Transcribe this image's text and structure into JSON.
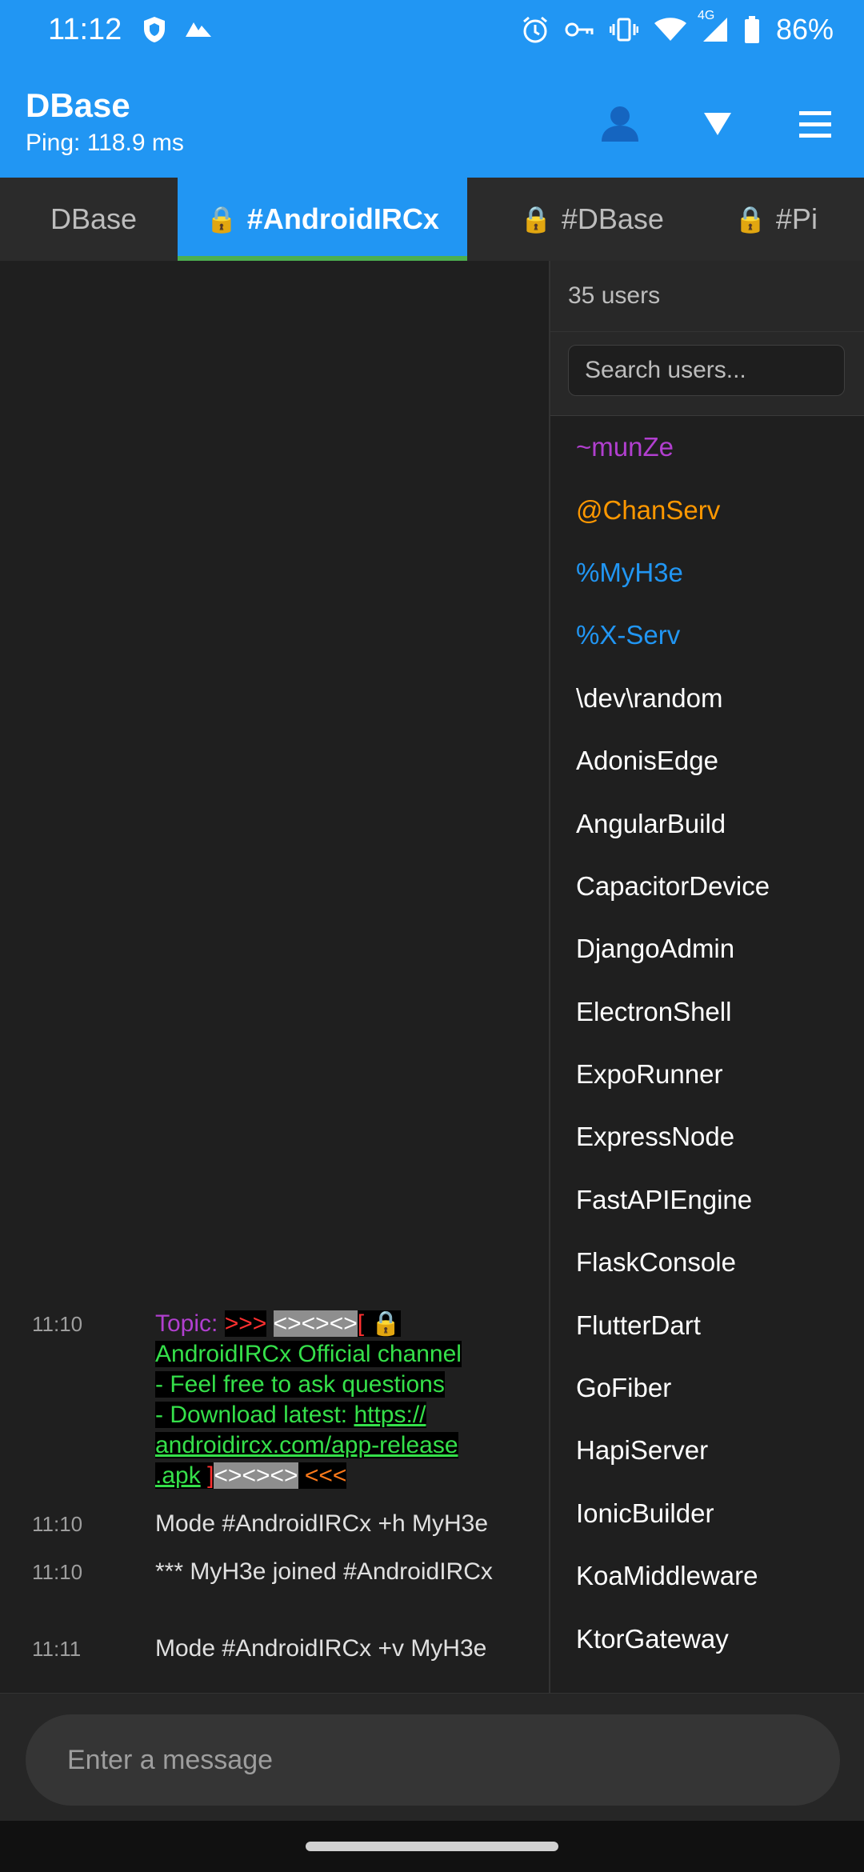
{
  "status_bar": {
    "time": "11:12",
    "battery_percent": "86%",
    "network_label": "4G",
    "icons": [
      "shield-icon",
      "drive-icon",
      "alarm-icon",
      "vpn-key-icon",
      "vibrate-icon",
      "wifi-icon",
      "signal-icon",
      "battery-icon"
    ]
  },
  "app_bar": {
    "title": "DBase",
    "subtitle": "Ping: 118.9 ms",
    "actions": [
      "users-icon",
      "dropdown-icon",
      "menu-icon"
    ],
    "accent": "#2196f3"
  },
  "tabs": [
    {
      "label": "DBase",
      "locked": false,
      "active": false
    },
    {
      "label": "#AndroidIRCx",
      "locked": true,
      "active": true
    },
    {
      "label": "#DBase",
      "locked": true,
      "active": false
    },
    {
      "label": "#Pi",
      "locked": true,
      "active": false
    }
  ],
  "messages": {
    "topic": {
      "time": "11:10",
      "label": "Topic:",
      "left_arrows": ">>>",
      "deco": "<><><>",
      "open_bracket": "[",
      "channel_line": "AndroidIRCx Official channel",
      "ask_line": "- Feel free to ask questions",
      "download_prefix": "- Download latest: ",
      "link": "https://androidircx.com/app-release.apk",
      "link_1": "https://",
      "link_2": "androidircx.com/app-release",
      "link_3": ".apk",
      "close_bracket": "]",
      "deco2": "<><><>",
      "right_arrows": "<<<"
    },
    "mode1": {
      "time": "11:10",
      "text": "Mode #AndroidIRCx +h MyH3e"
    },
    "join": {
      "time": "11:10",
      "text": "*** MyH3e joined #AndroidIRCx"
    },
    "mode2": {
      "time": "11:11",
      "text": "Mode #AndroidIRCx +v MyH3e"
    }
  },
  "users_panel": {
    "count_label": "35 users",
    "search_placeholder": "Search users...",
    "users": [
      {
        "name": "~munZe",
        "color": "#b13fcf"
      },
      {
        "name": "@ChanServ",
        "color": "#ff9800"
      },
      {
        "name": "%MyH3e",
        "color": "#2196f3"
      },
      {
        "name": "%X-Serv",
        "color": "#2196f3"
      },
      {
        "name": "\\dev\\random",
        "color": "#ffffff"
      },
      {
        "name": "AdonisEdge",
        "color": "#ffffff"
      },
      {
        "name": "AngularBuild",
        "color": "#ffffff"
      },
      {
        "name": "CapacitorDevice",
        "color": "#ffffff"
      },
      {
        "name": "DjangoAdmin",
        "color": "#ffffff"
      },
      {
        "name": "ElectronShell",
        "color": "#ffffff"
      },
      {
        "name": "ExpoRunner",
        "color": "#ffffff"
      },
      {
        "name": "ExpressNode",
        "color": "#ffffff"
      },
      {
        "name": "FastAPIEngine",
        "color": "#ffffff"
      },
      {
        "name": "FlaskConsole",
        "color": "#ffffff"
      },
      {
        "name": "FlutterDart",
        "color": "#ffffff"
      },
      {
        "name": "GoFiber",
        "color": "#ffffff"
      },
      {
        "name": "HapiServer",
        "color": "#ffffff"
      },
      {
        "name": "IonicBuilder",
        "color": "#ffffff"
      },
      {
        "name": "KoaMiddleware",
        "color": "#ffffff"
      },
      {
        "name": "KtorGateway",
        "color": "#ffffff"
      }
    ]
  },
  "input": {
    "placeholder": "Enter a message"
  }
}
